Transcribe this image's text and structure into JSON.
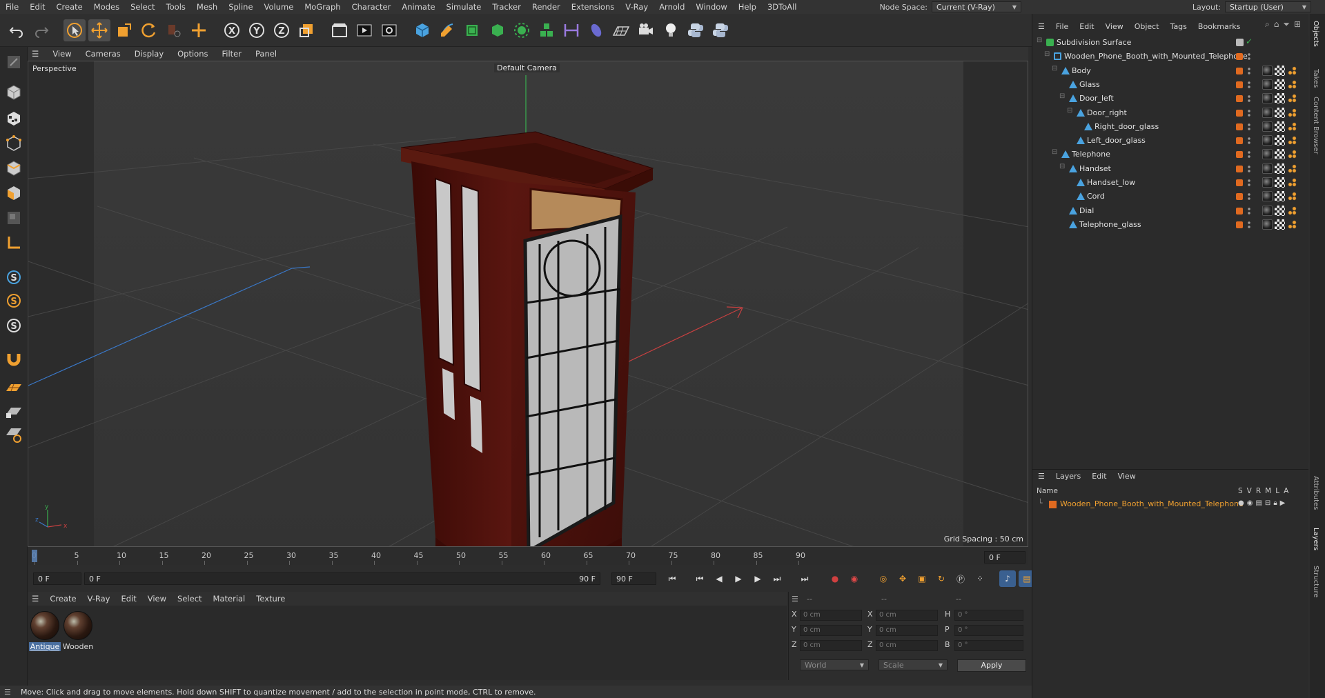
{
  "menubar": {
    "items": [
      "File",
      "Edit",
      "Create",
      "Modes",
      "Select",
      "Tools",
      "Mesh",
      "Spline",
      "Volume",
      "MoGraph",
      "Character",
      "Animate",
      "Simulate",
      "Tracker",
      "Render",
      "Extensions",
      "V-Ray",
      "Arnold",
      "Window",
      "Help",
      "3DToAll"
    ],
    "node_space_label": "Node Space:",
    "node_space_value": "Current (V-Ray)",
    "layout_label": "Layout:",
    "layout_value": "Startup (User)"
  },
  "viewport": {
    "menu": [
      "View",
      "Cameras",
      "Display",
      "Options",
      "Filter",
      "Panel"
    ],
    "label": "Perspective",
    "camera": "Default Camera",
    "grid_spacing": "Grid Spacing : 50 cm"
  },
  "timeline": {
    "ticks": [
      "0",
      "5",
      "10",
      "15",
      "20",
      "25",
      "30",
      "35",
      "40",
      "45",
      "50",
      "55",
      "60",
      "65",
      "70",
      "75",
      "80",
      "85",
      "90"
    ],
    "frame_end_box": "0 F",
    "current_frame": "0 F",
    "range_start": "0 F",
    "range_end": "90 F",
    "max_frame": "90 F"
  },
  "materials": {
    "menu": [
      "Create",
      "V-Ray",
      "Edit",
      "View",
      "Select",
      "Material",
      "Texture"
    ],
    "items": [
      {
        "label": "Antique",
        "selected": true
      },
      {
        "label": "Wooden",
        "selected": false
      }
    ]
  },
  "coords": {
    "headers": [
      "--",
      "--",
      "--"
    ],
    "rows": [
      {
        "a": "X",
        "av": "0 cm",
        "b": "X",
        "bv": "0 cm",
        "c": "H",
        "cv": "0 °"
      },
      {
        "a": "Y",
        "av": "0 cm",
        "b": "Y",
        "bv": "0 cm",
        "c": "P",
        "cv": "0 °"
      },
      {
        "a": "Z",
        "av": "0 cm",
        "b": "Z",
        "bv": "0 cm",
        "c": "B",
        "cv": "0 °"
      }
    ],
    "world": "World",
    "scale": "Scale",
    "apply": "Apply"
  },
  "status": "Move: Click and drag to move elements. Hold down SHIFT to quantize movement / add to the selection in point mode, CTRL to remove.",
  "objects": {
    "menu": [
      "File",
      "Edit",
      "View",
      "Object",
      "Tags",
      "Bookmarks"
    ],
    "tree": [
      {
        "name": "Subdivision Surface",
        "depth": 0,
        "type": "subdiv"
      },
      {
        "name": "Wooden_Phone_Booth_with_Mounted_Telephone",
        "depth": 1,
        "type": "null"
      },
      {
        "name": "Body",
        "depth": 2,
        "type": "poly"
      },
      {
        "name": "Glass",
        "depth": 3,
        "type": "poly"
      },
      {
        "name": "Door_left",
        "depth": 3,
        "type": "poly"
      },
      {
        "name": "Door_right",
        "depth": 4,
        "type": "poly"
      },
      {
        "name": "Right_door_glass",
        "depth": 5,
        "type": "poly"
      },
      {
        "name": "Left_door_glass",
        "depth": 4,
        "type": "poly"
      },
      {
        "name": "Telephone",
        "depth": 2,
        "type": "poly"
      },
      {
        "name": "Handset",
        "depth": 3,
        "type": "poly"
      },
      {
        "name": "Handset_low",
        "depth": 4,
        "type": "poly"
      },
      {
        "name": "Cord",
        "depth": 4,
        "type": "poly"
      },
      {
        "name": "Dial",
        "depth": 3,
        "type": "poly"
      },
      {
        "name": "Telephone_glass",
        "depth": 3,
        "type": "poly"
      }
    ]
  },
  "layers": {
    "menu": [
      "Layers",
      "Edit",
      "View"
    ],
    "head_name": "Name",
    "head_flags": [
      "S",
      "V",
      "R",
      "M",
      "L",
      "A"
    ],
    "row": "Wooden_Phone_Booth_with_Mounted_Telephone"
  },
  "vtabs": [
    "Objects",
    "Takes",
    "Content Browser",
    "Attributes",
    "Layers",
    "Structure"
  ],
  "colors": {
    "accent_orange": "#e06a20",
    "selection_blue": "#4a6fa0",
    "axis_blue": "#3a78c8",
    "axis_red": "#c84040",
    "axis_green": "#3ab050"
  }
}
